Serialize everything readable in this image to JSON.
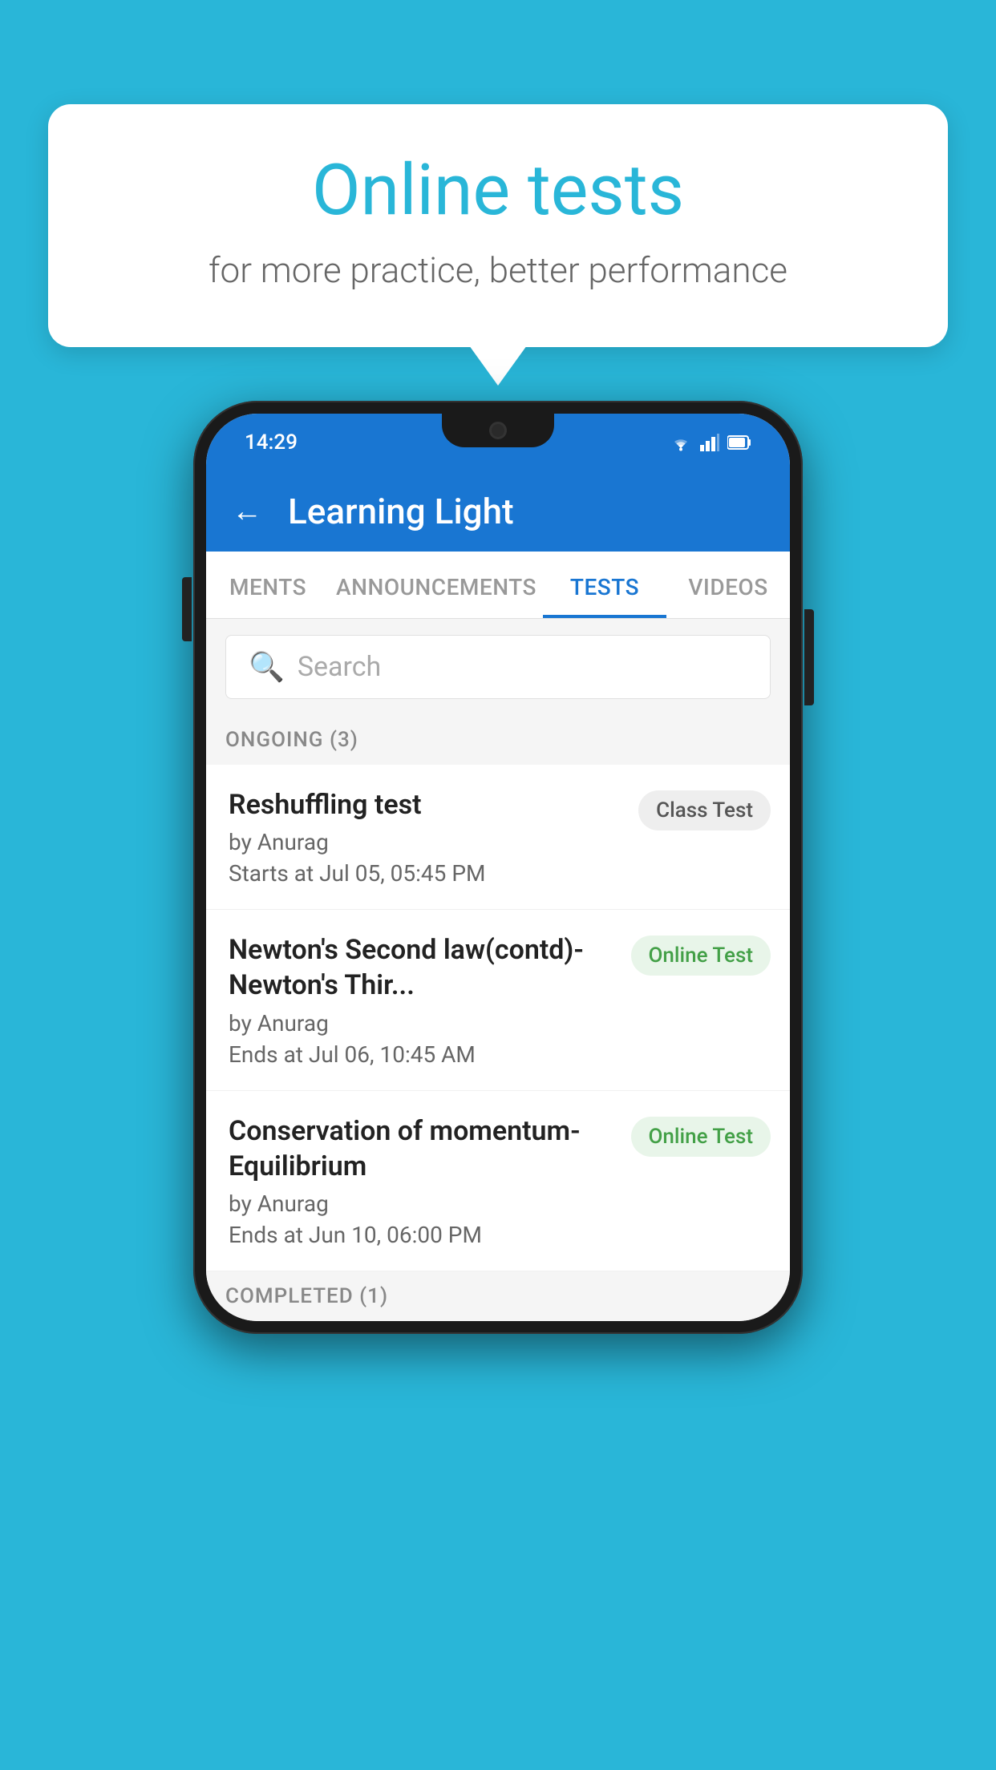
{
  "background_color": "#29B6D8",
  "bubble": {
    "title": "Online tests",
    "subtitle": "for more practice, better performance"
  },
  "status_bar": {
    "time": "14:29"
  },
  "app_header": {
    "title": "Learning Light",
    "back_label": "←"
  },
  "tabs": [
    {
      "label": "MENTS",
      "active": false
    },
    {
      "label": "ANNOUNCEMENTS",
      "active": false
    },
    {
      "label": "TESTS",
      "active": true
    },
    {
      "label": "VIDEOS",
      "active": false
    }
  ],
  "search": {
    "placeholder": "Search"
  },
  "ongoing": {
    "header": "ONGOING (3)",
    "tests": [
      {
        "name": "Reshuffling test",
        "by": "by Anurag",
        "date": "Starts at  Jul 05, 05:45 PM",
        "badge": "Class Test",
        "badge_type": "class"
      },
      {
        "name": "Newton's Second law(contd)-Newton's Thir...",
        "by": "by Anurag",
        "date": "Ends at  Jul 06, 10:45 AM",
        "badge": "Online Test",
        "badge_type": "online"
      },
      {
        "name": "Conservation of momentum-Equilibrium",
        "by": "by Anurag",
        "date": "Ends at  Jun 10, 06:00 PM",
        "badge": "Online Test",
        "badge_type": "online"
      }
    ]
  },
  "completed": {
    "header": "COMPLETED (1)"
  }
}
